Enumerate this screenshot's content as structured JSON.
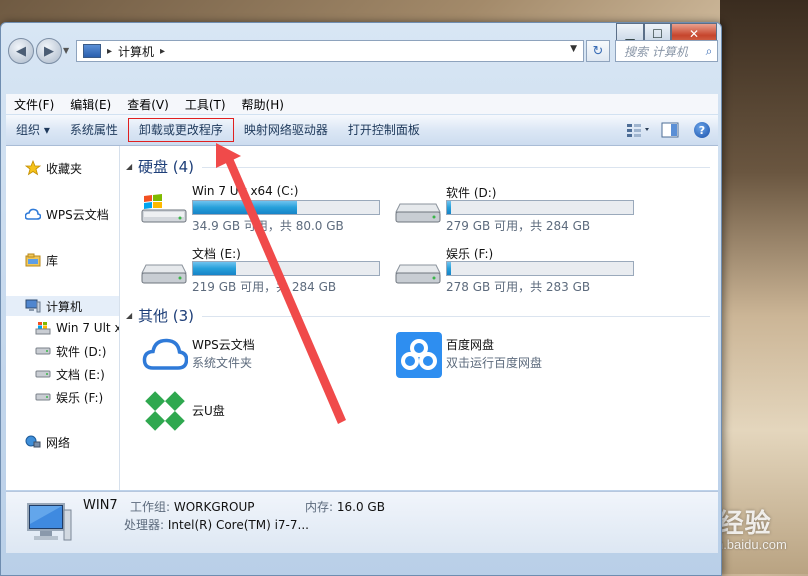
{
  "window": {
    "address_path": "计算机",
    "search_placeholder": "搜索 计算机",
    "caption": {
      "minimize": "▁",
      "maximize": "☐",
      "close": "✕"
    }
  },
  "menu": [
    "文件(F)",
    "编辑(E)",
    "查看(V)",
    "工具(T)",
    "帮助(H)"
  ],
  "commands": {
    "organize": "组织 ▾",
    "system_properties": "系统属性",
    "uninstall": "卸载或更改程序",
    "map_drive": "映射网络驱动器",
    "control_panel": "打开控制面板"
  },
  "nav": {
    "favorites": "收藏夹",
    "wps": "WPS云文档",
    "libraries": "库",
    "computer": "计算机",
    "drive_c": "Win 7 Ult x",
    "drive_d": "软件 (D:)",
    "drive_e": "文档 (E:)",
    "drive_f": "娱乐 (F:)",
    "network": "网络"
  },
  "groups": {
    "hard_disks": "硬盘 (4)",
    "other": "其他 (3)"
  },
  "drives": [
    {
      "name": "Win 7 Ult x64 (C:)",
      "free": "34.9 GB 可用，共 80.0 GB",
      "used_fraction": 0.56
    },
    {
      "name": "软件 (D:)",
      "free": "279 GB 可用，共 284 GB",
      "used_fraction": 0.02
    },
    {
      "name": "文档 (E:)",
      "free": "219 GB 可用，共 284 GB",
      "used_fraction": 0.23
    },
    {
      "name": "娱乐 (F:)",
      "free": "278 GB 可用，共 283 GB",
      "used_fraction": 0.02
    }
  ],
  "others": [
    {
      "name": "WPS云文档",
      "desc": "系统文件夹"
    },
    {
      "name": "百度网盘",
      "desc": "双击运行百度网盘"
    },
    {
      "name": "云U盘",
      "desc": ""
    }
  ],
  "details": {
    "pc_name": "WIN7",
    "workgroup_label": "工作组:",
    "workgroup": "WORKGROUP",
    "memory_label": "内存:",
    "memory": "16.0 GB",
    "cpu_label": "处理器:",
    "cpu": "Intel(R) Core(TM) i7-7..."
  },
  "watermark": {
    "logo": "Bai du 经验",
    "url": "jingyan.baidu.com"
  },
  "colors": {
    "accent": "#1e3f79",
    "highlight_border": "#e02020",
    "arrow": "#f04a4a",
    "bar_fill": "#26a0da"
  }
}
